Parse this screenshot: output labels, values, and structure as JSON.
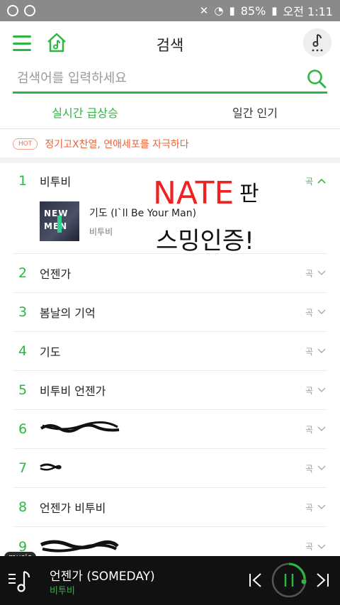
{
  "status_bar": {
    "battery": "85%",
    "time": "오전 1:11"
  },
  "header": {
    "title": "검색",
    "menu_icon": "hamburger-icon",
    "home_icon": "home-music-icon",
    "note_icon": "music-note-more-icon"
  },
  "search": {
    "placeholder": "검색어를 입력하세요",
    "value": ""
  },
  "tabs": [
    {
      "label": "실시간 급상승",
      "active": true
    },
    {
      "label": "일간 인기",
      "active": false
    }
  ],
  "hot": {
    "badge": "HOT",
    "text": "정기고X찬열, 연애세포를 자극하다"
  },
  "ranking": [
    {
      "rank": "1",
      "term": "비투비",
      "type": "곡",
      "expanded": true,
      "song": {
        "title": "기도 (I`ll Be Your Man)",
        "artist": "비투비"
      }
    },
    {
      "rank": "2",
      "term": "언젠가",
      "type": "곡"
    },
    {
      "rank": "3",
      "term": "봄날의 기억",
      "type": "곡"
    },
    {
      "rank": "4",
      "term": "기도",
      "type": "곡"
    },
    {
      "rank": "5",
      "term": "비투비 언젠가",
      "type": "곡"
    },
    {
      "rank": "6",
      "term": "",
      "type": "곡"
    },
    {
      "rank": "7",
      "term": "",
      "type": "곡"
    },
    {
      "rank": "8",
      "term": "언젠가 비투비",
      "type": "곡"
    },
    {
      "rank": "9",
      "term": "",
      "type": "곡"
    }
  ],
  "album_art": {
    "line1": "NEW",
    "line2": "MEN"
  },
  "overlay": {
    "line1": "NATE",
    "line2": "판",
    "line3": "스밍인증!"
  },
  "player": {
    "tag": "music",
    "title": "언젠가 (SOMEDAY)",
    "artist": "비투비"
  },
  "colors": {
    "accent": "#2db742",
    "hot": "#e8633a",
    "player_bg": "#111111"
  }
}
